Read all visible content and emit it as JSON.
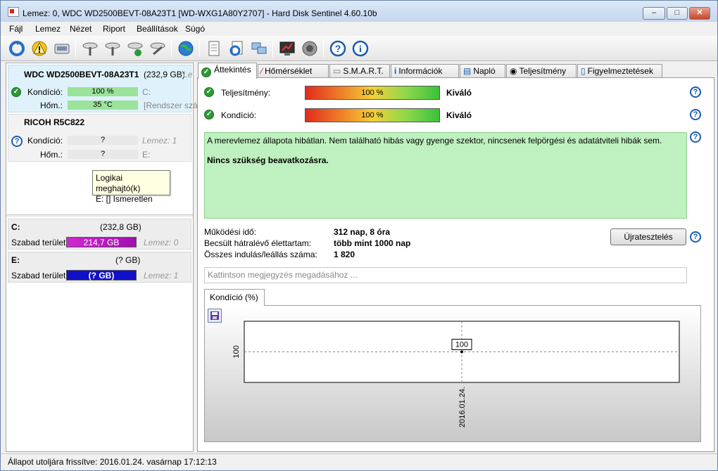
{
  "window": {
    "title": "Lemez: 0, WDC WD2500BEVT-08A23T1 [WD-WXG1A80Y2707]  -  Hard Disk Sentinel 4.60.10b",
    "minimize": "–",
    "maximize": "□",
    "close": "✕"
  },
  "menu": [
    "Fájl",
    "Lemez",
    "Nézet",
    "Riport",
    "Beállítások",
    "Súgó"
  ],
  "toolbar_icons": [
    "refresh-icon",
    "warning-icon",
    "disk-icon",
    "disk-tool-1-icon",
    "disk-tool-2-icon",
    "disk-tool-3-icon",
    "disk-tool-4-icon",
    "globe-icon",
    "report-icon",
    "sync-icon",
    "network-icon",
    "benchmark-icon",
    "speaker-icon",
    "help-icon",
    "info-icon"
  ],
  "disks": [
    {
      "name": "WDC WD2500BEVT-08A23T1",
      "size": "(232,9 GB)",
      "extra": "Le",
      "condition_label": "Kondíció:",
      "condition": "100 %",
      "drive_letter": "C:",
      "temp_label": "Hőm.:",
      "temp": "35 °C",
      "temp_note": "[Rendszer szá"
    },
    {
      "name": "RICOH   R5C822",
      "condition_label": "Kondíció:",
      "condition": "?",
      "disk_note": "Lemez: 1",
      "temp_label": "Hőm.:",
      "temp": "?",
      "drive_letter": "E:"
    }
  ],
  "tooltip": {
    "line1": "Logikai meghajtó(k)",
    "line2": "E: [] Ismeretlen"
  },
  "partitions": [
    {
      "letter": "C:",
      "size": "(232,8 GB)",
      "free_label": "Szabad terület",
      "free": "214,7 GB",
      "disk": "Lemez: 0"
    },
    {
      "letter": "E:",
      "size": "(? GB)",
      "free_label": "Szabad terület",
      "free": "(? GB)",
      "disk": "Lemez: 1"
    }
  ],
  "tabs": [
    "Áttekintés",
    "Hőmérséklet",
    "S.M.A.R.T.",
    "Információk",
    "Napló",
    "Teljesítmény",
    "Figyelmeztetések"
  ],
  "overview": {
    "performance_label": "Teljesítmény:",
    "performance_value": "100 %",
    "performance_rating": "Kiváló",
    "condition_label": "Kondíció:",
    "condition_value": "100 %",
    "condition_rating": "Kiváló",
    "message": "A merevlemez állapota hibátlan. Nem található hibás vagy gyenge szektor, nincsenek felpörgési és adatátviteli hibák sem.",
    "action": "Nincs szükség beavatkozásra.",
    "uptime_label": "Működési idő:",
    "uptime": "312 nap, 8 óra",
    "lifetime_label": "Becsült hátralévő élettartam:",
    "lifetime": "több mint 1000 nap",
    "starts_label": "Összes indulás/leállás száma:",
    "starts": "1 820",
    "retest_button": "Újratesztelés",
    "note_placeholder": "Kattintson megjegyzés megadásához ...",
    "chart_tab": "Kondíció  (%)"
  },
  "chart_data": {
    "type": "line",
    "x": [
      "2016.01.24."
    ],
    "series": [
      {
        "values": [
          100
        ]
      }
    ],
    "ytick": "100",
    "data_label": "100",
    "xtick": "2016.01.24."
  },
  "status": "Állapot utoljára frissítve: 2016.01.24. vasárnap 17:12:13",
  "colors": {
    "ok": "#2e9a35",
    "help": "#1a5cb0",
    "message_bg": "#bff0bf",
    "free_c": "#c020c0",
    "free_e": "#1010c8"
  }
}
